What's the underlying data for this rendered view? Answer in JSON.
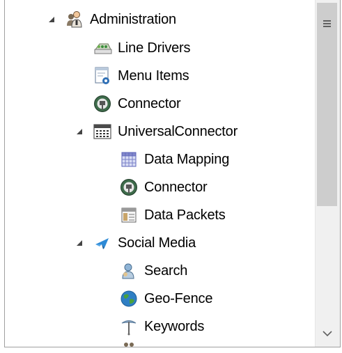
{
  "tree": {
    "items": [
      {
        "label": "Administration",
        "icon": "admin-users-icon",
        "expanded": true
      },
      {
        "label": "Line Drivers",
        "icon": "line-drivers-icon"
      },
      {
        "label": "Menu Items",
        "icon": "menu-items-icon"
      },
      {
        "label": "Connector",
        "icon": "connector-icon"
      },
      {
        "label": "UniversalConnector",
        "icon": "calculator-icon",
        "expanded": true
      },
      {
        "label": "Data Mapping",
        "icon": "data-mapping-icon"
      },
      {
        "label": "Connector",
        "icon": "connector-icon"
      },
      {
        "label": "Data Packets",
        "icon": "data-packets-icon"
      },
      {
        "label": "Social Media",
        "icon": "social-media-icon",
        "expanded": true
      },
      {
        "label": "Search",
        "icon": "search-people-icon"
      },
      {
        "label": "Geo-Fence",
        "icon": "globe-icon"
      },
      {
        "label": "Keywords",
        "icon": "keywords-icon"
      }
    ]
  },
  "colors": {
    "scroll_track": "#f0f0f0",
    "scroll_thumb": "#cdcdcd",
    "border": "#a0a0a0"
  }
}
